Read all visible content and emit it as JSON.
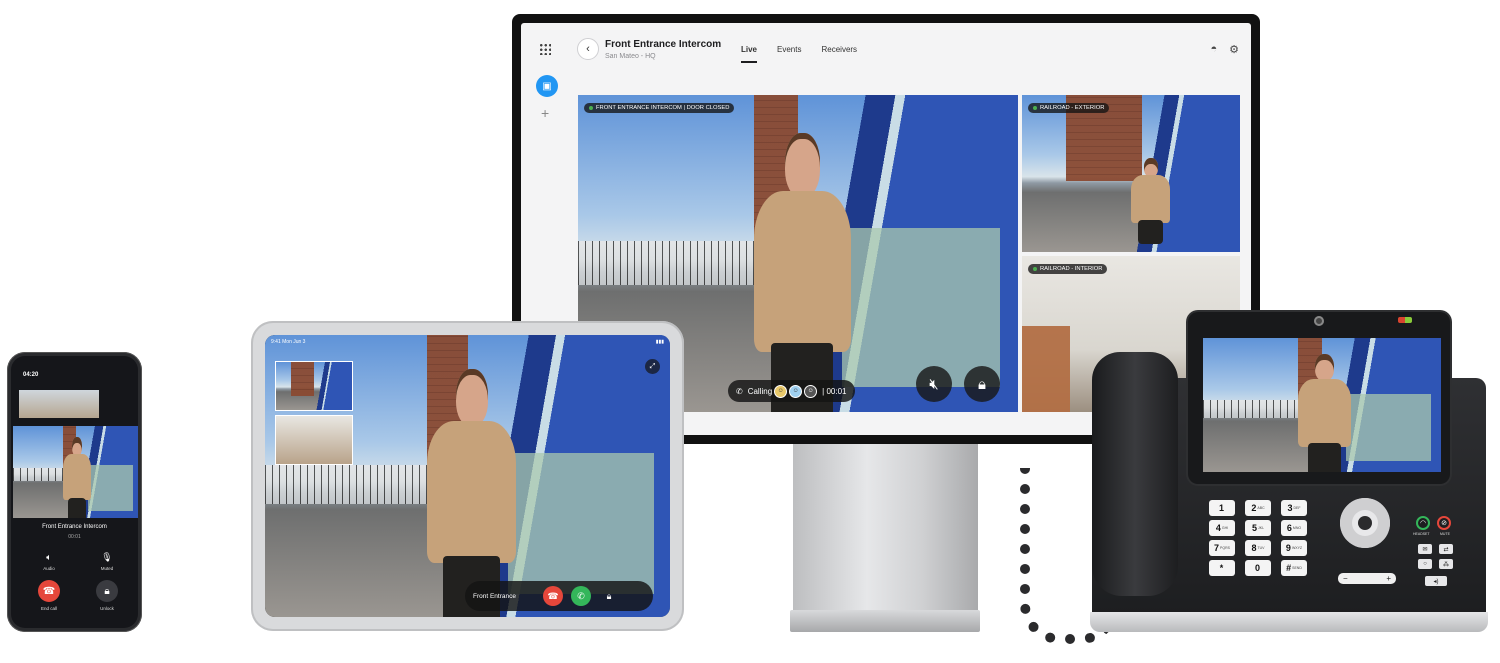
{
  "monitor": {
    "title": "Front Entrance Intercom",
    "subtitle": "San Mateo - HQ",
    "tabs": [
      "Live",
      "Events",
      "Receivers"
    ],
    "active_tab": "Live",
    "feeds": {
      "main_label": "FRONT ENTRANCE INTERCOM | DOOR CLOSED",
      "a_label": "RAILROAD - EXTERIOR",
      "b_label": "RAILROAD - INTERIOR"
    },
    "call_status": "Calling",
    "call_timer": "| 00:01"
  },
  "tablet": {
    "time": "9:41 Mon Jun 3",
    "call_label": "Front Entrance"
  },
  "phone": {
    "time": "04:20",
    "name": "Front Entrance Intercom",
    "timer": "00:01",
    "controls": {
      "audio": "Audio",
      "muted": "Muted",
      "end_call": "End call",
      "unlock": "Unlock"
    }
  },
  "deskphone": {
    "keys": [
      {
        "num": "1",
        "letters": ""
      },
      {
        "num": "2",
        "letters": "ABC"
      },
      {
        "num": "3",
        "letters": "DEF"
      },
      {
        "num": "4",
        "letters": "GHI"
      },
      {
        "num": "5",
        "letters": "JKL"
      },
      {
        "num": "6",
        "letters": "MNO"
      },
      {
        "num": "7",
        "letters": "PQRS"
      },
      {
        "num": "8",
        "letters": "TUV"
      },
      {
        "num": "9",
        "letters": "WXYZ"
      },
      {
        "num": "*",
        "letters": ""
      },
      {
        "num": "0",
        "letters": ""
      },
      {
        "num": "#",
        "letters": "SEND"
      }
    ],
    "headset_label": "HEADSET",
    "mute_label": "MUTE",
    "vol_minus": "−",
    "vol_plus": "+"
  },
  "colors": {
    "accent_blue": "#2196f3",
    "end_red": "#e5473b",
    "answer_green": "#34b65a"
  }
}
